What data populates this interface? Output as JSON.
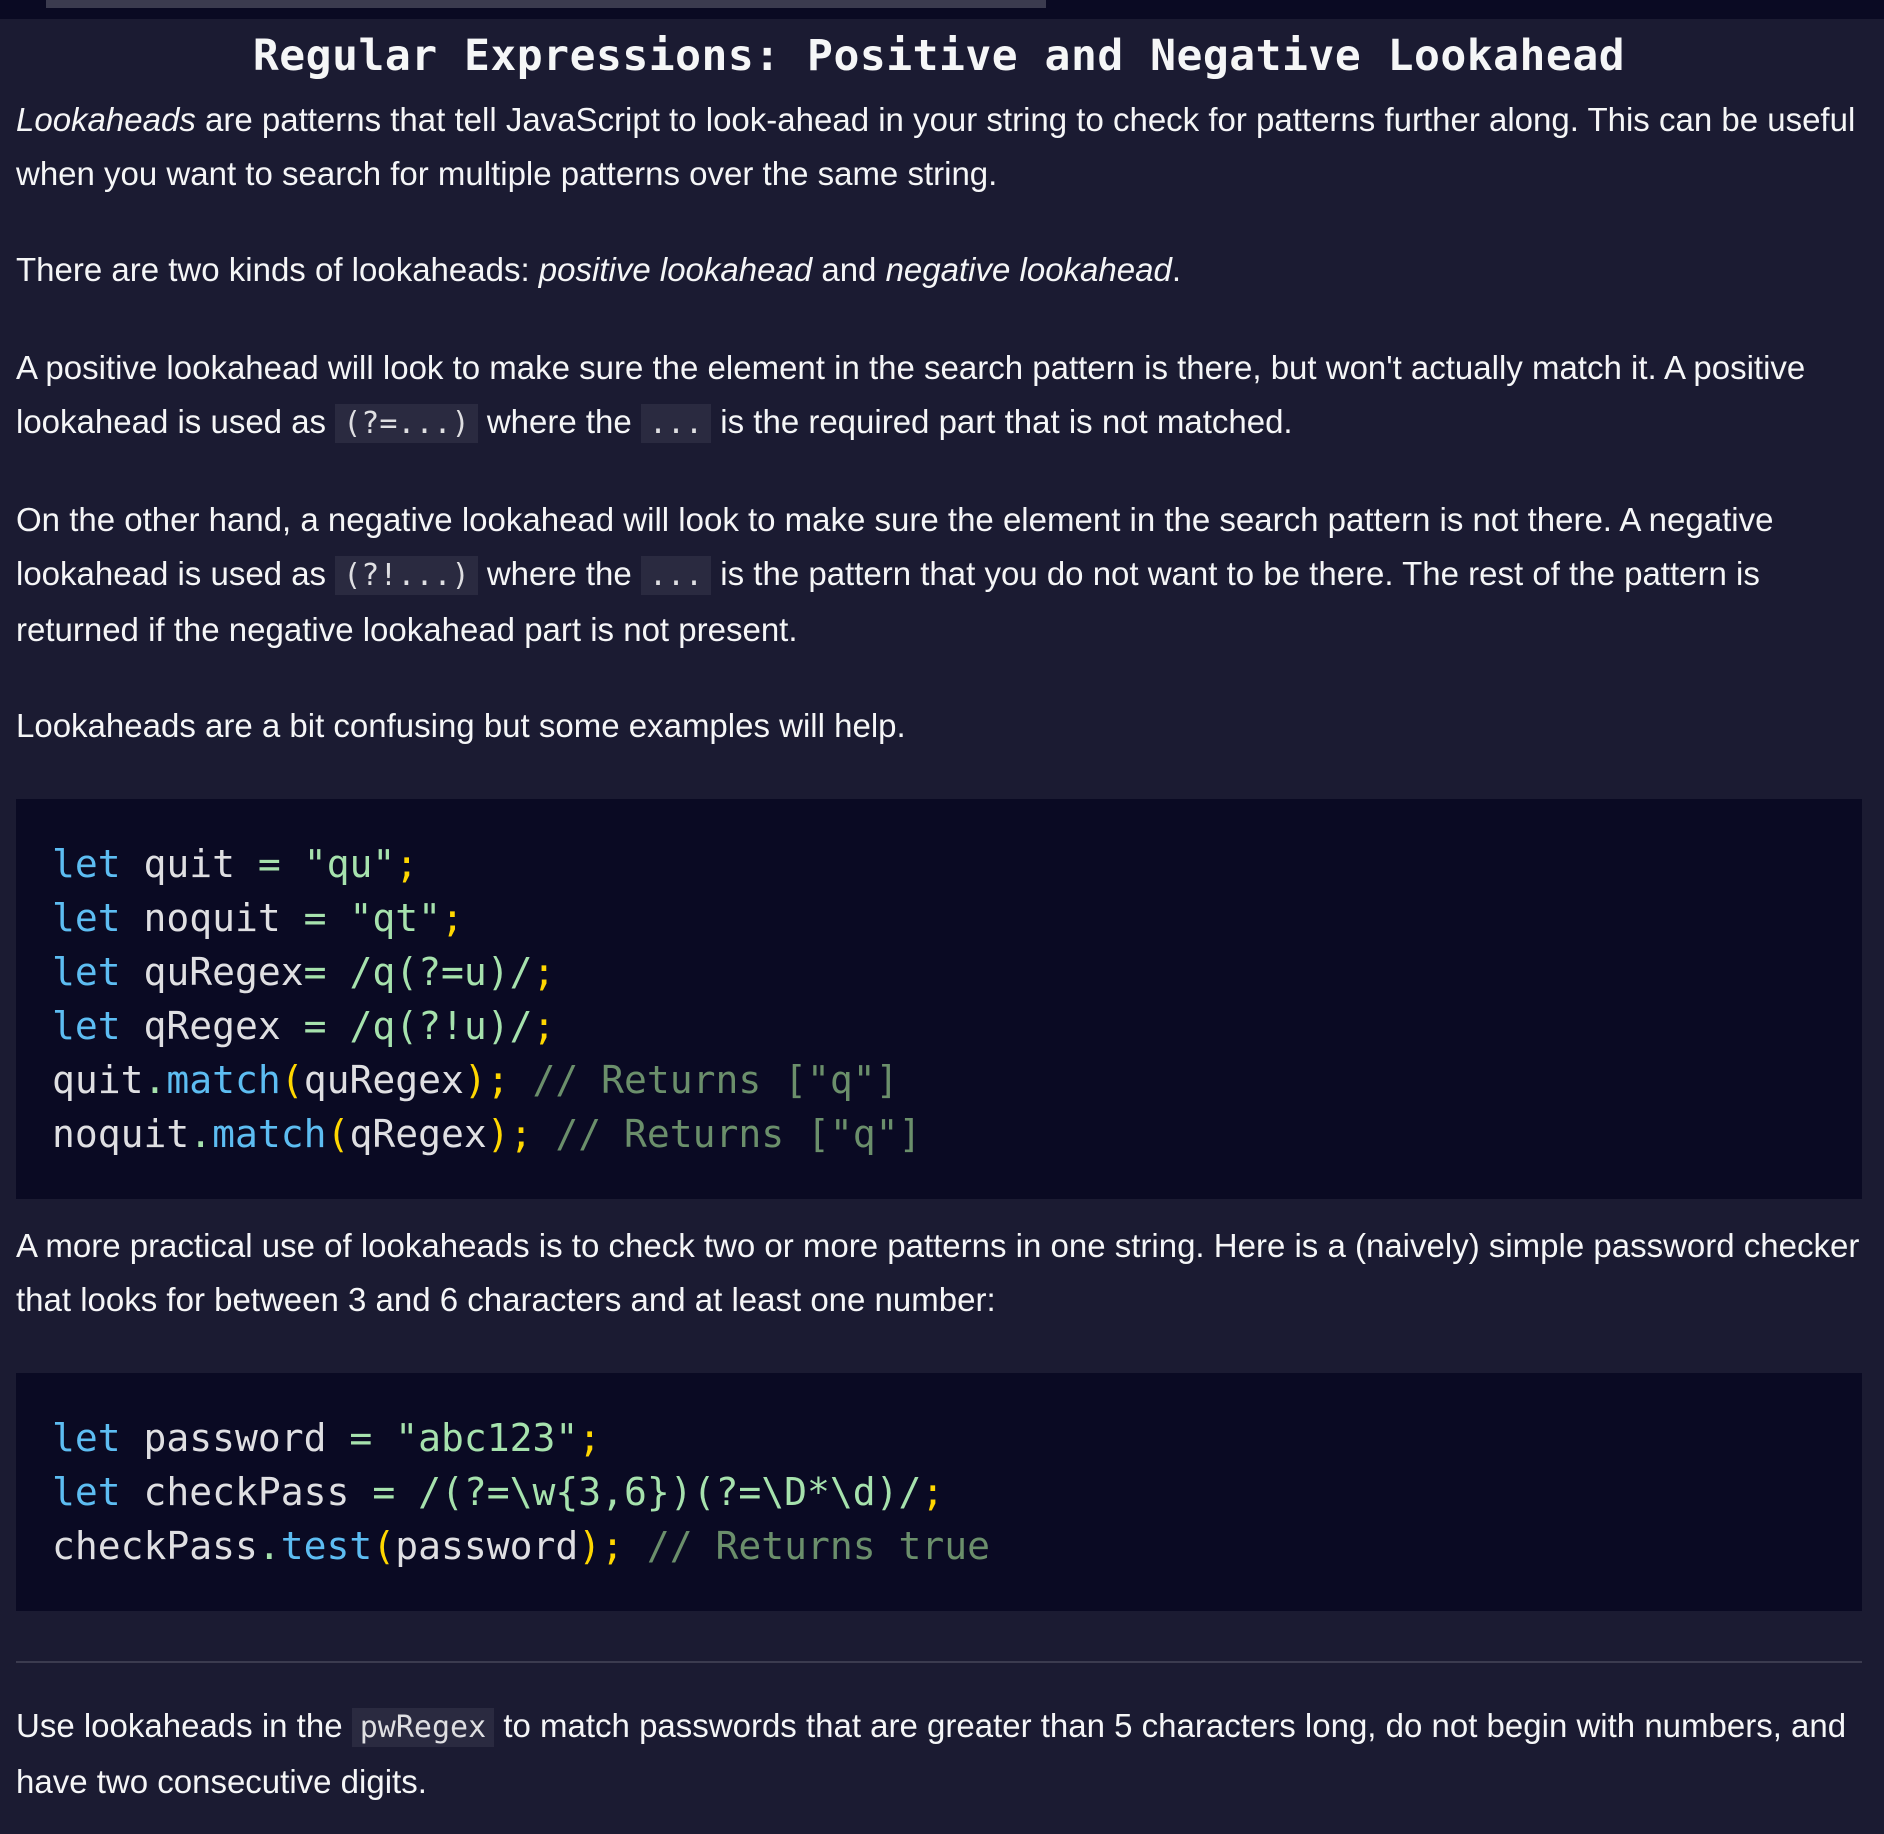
{
  "page": {
    "title": "Regular Expressions: Positive and Negative Lookahead"
  },
  "para1": {
    "em": "Lookaheads",
    "text": " are patterns that tell JavaScript to look-ahead in your string to check for patterns further along. This can be useful when you want to search for multiple patterns over the same string."
  },
  "para2": {
    "a": "There are two kinds of lookaheads: ",
    "em1": "positive lookahead",
    "b": " and ",
    "em2": "negative lookahead",
    "c": "."
  },
  "para3": {
    "a": "A positive lookahead will look to make sure the element in the search pattern is there, but won't actually match it. A positive lookahead is used as ",
    "code1": "(?=...)",
    "b": " where the ",
    "code2": "...",
    "c": " is the required part that is not matched."
  },
  "para4": {
    "a": "On the other hand, a negative lookahead will look to make sure the element in the search pattern is not there. A negative lookahead is used as ",
    "code1": "(?!...)",
    "b": " where the ",
    "code2": "...",
    "c": " is the pattern that you do not want to be there. The rest of the pattern is returned if the negative lookahead part is not present."
  },
  "para5": "Lookaheads are a bit confusing but some examples will help.",
  "code1": {
    "line1": {
      "kw": "let",
      "name": " quit ",
      "op": "=",
      "str": " \"qu\"",
      "semi": ";"
    },
    "line2": {
      "kw": "let",
      "name": " noquit ",
      "op": "=",
      "str": " \"qt\"",
      "semi": ";"
    },
    "line3": {
      "kw": "let",
      "name": " quRegex",
      "op": "=",
      "rgx": " /q(?=u)/",
      "semi": ";"
    },
    "line4": {
      "kw": "let",
      "name": " qRegex ",
      "op": "=",
      "rgx": " /q(?!u)/",
      "semi": ";"
    },
    "line5": {
      "obj": "quit",
      "dot": ".",
      "fn": "match",
      "open": "(",
      "arg": "quRegex",
      "close": ")",
      "semi": "; ",
      "cm": "// Returns [\"q\"]"
    },
    "line6": {
      "obj": "noquit",
      "dot": ".",
      "fn": "match",
      "open": "(",
      "arg": "qRegex",
      "close": ")",
      "semi": "; ",
      "cm": "// Returns [\"q\"]"
    }
  },
  "para6": "A more practical use of lookaheads is to check two or more patterns in one string. Here is a (naively) simple password checker that looks for between 3 and 6 characters and at least one number:",
  "code2": {
    "line1": {
      "kw": "let",
      "name": " password ",
      "op": "=",
      "str": " \"abc123\"",
      "semi": ";"
    },
    "line2": {
      "kw": "let",
      "name": " checkPass ",
      "op": "=",
      "rgx": " /(?=\\w{3,6})(?=\\D*\\d)/",
      "semi": ";"
    },
    "line3": {
      "obj": "checkPass",
      "dot": ".",
      "fn": "test",
      "open": "(",
      "arg": "password",
      "close": ")",
      "semi": "; ",
      "cm": "// Returns true"
    }
  },
  "task": {
    "a": "Use lookaheads in the ",
    "code": "pwRegex",
    "b": " to match passwords that are greater than 5 characters long, do not begin with numbers, and have two consecutive digits."
  }
}
